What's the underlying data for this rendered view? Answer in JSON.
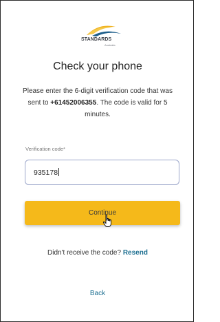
{
  "logo": {
    "name": "STANDARDS",
    "subtext": "Australia"
  },
  "page": {
    "title": "Check your phone",
    "message_before": "Please enter the 6-digit verification code that was sent to ",
    "phone_number": "+61452006355",
    "message_after": ". The code is valid for 5 minutes."
  },
  "form": {
    "code_label": "Verification code",
    "required_marker": "*",
    "code_value": "935178"
  },
  "actions": {
    "continue_label": "Continue",
    "resend_prompt": "Didn't receive the code?",
    "resend_label": "Resend",
    "back_label": "Back"
  },
  "colors": {
    "button_yellow": "#f5b91a",
    "link_blue": "#1d6f91",
    "input_border": "#9aa5c9"
  }
}
